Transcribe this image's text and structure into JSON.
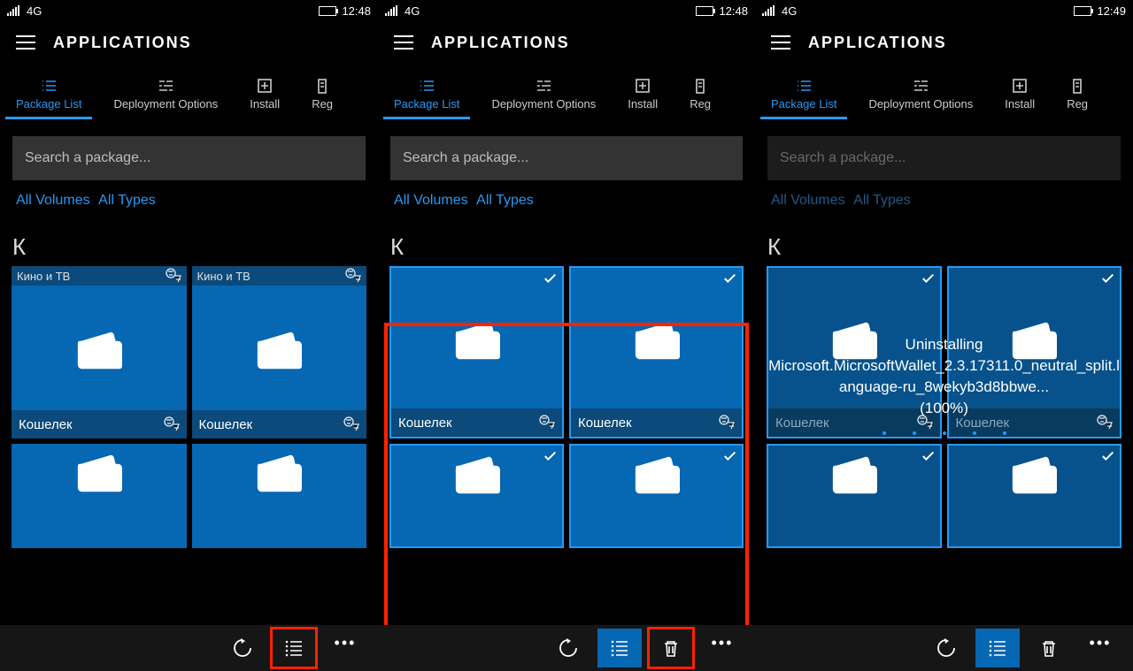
{
  "screens": [
    {
      "status": {
        "net": "4G",
        "time": "12:48"
      },
      "title": "APPLICATIONS",
      "tabs": [
        "Package List",
        "Deployment Options",
        "Install",
        "Reg"
      ],
      "search_placeholder": "Search a package...",
      "filters": [
        "All Volumes",
        "All Types"
      ],
      "letter": "К",
      "top_label": "Кино и ТВ",
      "tile_label": "Кошелек",
      "bottom_highlight": "list"
    },
    {
      "status": {
        "net": "4G",
        "time": "12:48"
      },
      "title": "APPLICATIONS",
      "tabs": [
        "Package List",
        "Deployment Options",
        "Install",
        "Reg"
      ],
      "search_placeholder": "Search a package...",
      "filters": [
        "All Volumes",
        "All Types"
      ],
      "letter": "К",
      "tile_label": "Кошелек",
      "bottom_highlight": "delete"
    },
    {
      "status": {
        "net": "4G",
        "time": "12:49"
      },
      "title": "APPLICATIONS",
      "tabs": [
        "Package List",
        "Deployment Options",
        "Install",
        "Reg"
      ],
      "search_placeholder": "Search a package...",
      "filters": [
        "All Volumes",
        "All Types"
      ],
      "letter": "К",
      "tile_label": "Кошелек",
      "overlay_lines": [
        "Uninstalling",
        "Microsoft.MicrosoftWallet_2.3.17311.0_neutral_split.language-ru_8wekyb3d8bbwe...",
        "(100%)"
      ]
    }
  ]
}
